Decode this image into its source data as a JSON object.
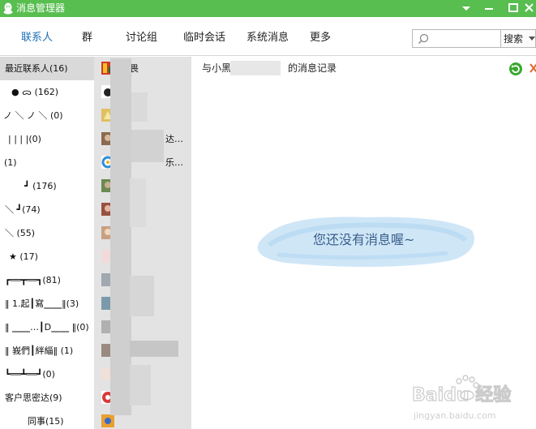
{
  "window": {
    "title": "消息管理器",
    "controls": [
      "dropdown-icon",
      "minimize-icon",
      "maximize-icon",
      "close-icon"
    ]
  },
  "nav": {
    "tabs": [
      {
        "label": "联系人",
        "active": true
      },
      {
        "label": "群",
        "active": false
      },
      {
        "label": "讨论组",
        "active": false
      },
      {
        "label": "临时会话",
        "active": false
      },
      {
        "label": "系统消息",
        "active": false
      },
      {
        "label": "更多",
        "active": false
      }
    ],
    "search": {
      "value": "",
      "placeholder": "",
      "icon": "search-icon"
    },
    "search_button": "搜索"
  },
  "groups": [
    {
      "label": "最近联系人(16)",
      "selected": true
    },
    {
      "label": "●   ᯅ   (162)",
      "selected": false
    },
    {
      "label": "ノ ＼ ノ ＼ (0)",
      "selected": false
    },
    {
      "label": "| |    | |(0)",
      "selected": false
    },
    {
      "label": "(1)",
      "selected": false
    },
    {
      "label": "┛   (176)",
      "selected": false
    },
    {
      "label": "＼   ┛(74)",
      "selected": false
    },
    {
      "label": "＼   (55)",
      "selected": false
    },
    {
      "label": "★    (17)",
      "selected": false
    },
    {
      "label": "┏══┳══┓(81)",
      "selected": false
    },
    {
      "label": "‖ 1.起┃寫⎽⎽‖(3)",
      "selected": false
    },
    {
      "label": "‖ ⎽⎽…┃D⎽⎽ ‖(0)",
      "selected": false
    },
    {
      "label": "‖ 峩們┃絆緇‖ (1)",
      "selected": false
    },
    {
      "label": "┗══┻══┛(0)",
      "selected": false
    },
    {
      "label": "客户思密达(9)",
      "selected": false
    },
    {
      "label": "同事(15)",
      "selected": false
    }
  ],
  "contacts": [
    {
      "name": "畏",
      "avatar_color": "#d13a2a"
    },
    {
      "name": "",
      "avatar_color": "#222222"
    },
    {
      "name": "",
      "avatar_color": "#e0c060"
    },
    {
      "name": "达…",
      "avatar_color": "#8a6a50"
    },
    {
      "name": "乐…",
      "avatar_color": "#2f8fd8"
    },
    {
      "name": "",
      "avatar_color": "#6a8a50"
    },
    {
      "name": "",
      "avatar_color": "#9a5040"
    },
    {
      "name": "",
      "avatar_color": "#c8a080"
    },
    {
      "name": "",
      "avatar_color": "#9aa0a0"
    },
    {
      "name": "",
      "avatar_color": "#a0a8b0"
    },
    {
      "name": "",
      "avatar_color": "#7a9aaa"
    },
    {
      "name": "",
      "avatar_color": "#b0b0b0"
    },
    {
      "name": "",
      "avatar_color": "#9a8a80"
    },
    {
      "name": "",
      "avatar_color": "#f0e0d8"
    },
    {
      "name": "",
      "avatar_color": "#d83a3a"
    },
    {
      "name": "",
      "avatar_color": "#e8a030"
    }
  ],
  "message": {
    "header_prefix": "与小黑",
    "header_suffix": "的消息记录",
    "empty_text": "您还没有消息喔~",
    "refresh_icon": "refresh-icon",
    "close_icon": "close-icon"
  },
  "watermark": {
    "text": "Baidu 经验",
    "url_text": "jingyan.baidu.com"
  },
  "colors": {
    "titlebar": "#58be50",
    "tab_active": "#1f6fb5",
    "group_selected": "#d9d9d9",
    "contact_bg": "#e3e3e3",
    "bubble": "#a8d2f0"
  }
}
